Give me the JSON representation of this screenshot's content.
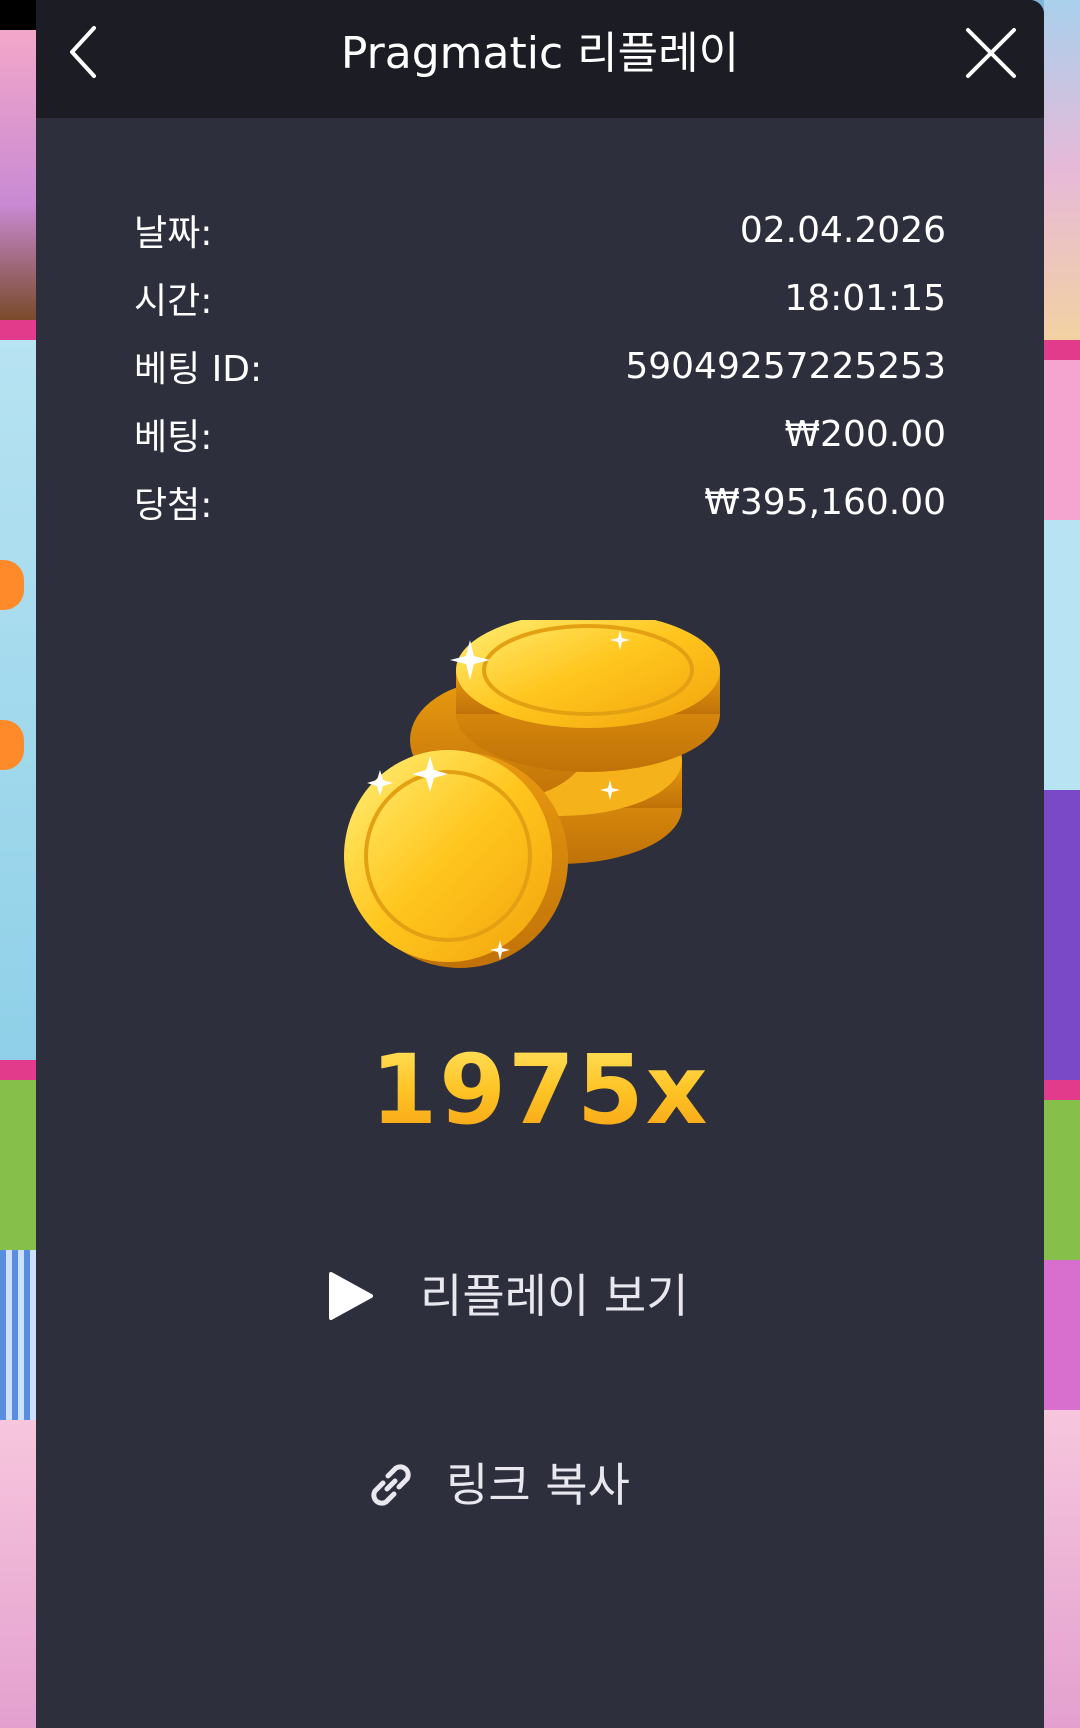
{
  "header": {
    "title": "Pragmatic 리플레이",
    "back_icon": "chevron-left-icon",
    "close_icon": "close-icon"
  },
  "details": [
    {
      "label": "날짜:",
      "value": "02.04.2026"
    },
    {
      "label": "시간:",
      "value": "18:01:15"
    },
    {
      "label": "베팅 ID:",
      "value": "59049257225253"
    },
    {
      "label": "베팅:",
      "value": "₩200.00"
    },
    {
      "label": "당첨:",
      "value": "₩395,160.00"
    }
  ],
  "result": {
    "multiplier": "1975x",
    "image_icon": "gold-coins-icon"
  },
  "actions": {
    "replay_label": "리플레이 보기",
    "replay_icon": "play-icon",
    "copy_label": "링크 복사",
    "copy_icon": "link-icon"
  },
  "colors": {
    "dialog_bg": "#2e2f3d",
    "topbar_bg": "#1c1c24",
    "text": "#ffffff",
    "multiplier": "#ffbf22"
  }
}
